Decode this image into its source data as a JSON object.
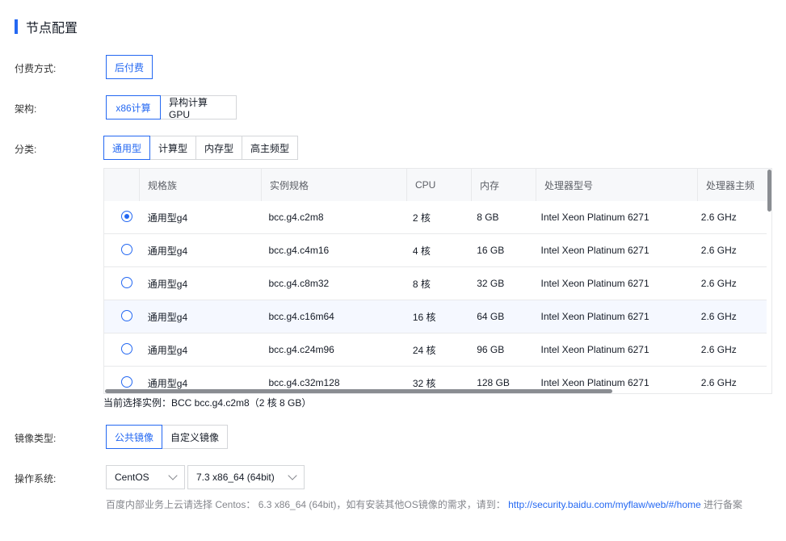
{
  "section_title": "节点配置",
  "payment": {
    "label": "付费方式:",
    "options": [
      "后付费"
    ],
    "selected": 0
  },
  "arch": {
    "label": "架构:",
    "options": [
      "x86计算",
      "异构计算GPU"
    ],
    "selected": 0
  },
  "category": {
    "label": "分类:",
    "options": [
      "通用型",
      "计算型",
      "内存型",
      "高主频型"
    ],
    "selected": 0
  },
  "table": {
    "headers": [
      "规格族",
      "实例规格",
      "CPU",
      "内存",
      "处理器型号",
      "处理器主频"
    ],
    "rows": [
      {
        "family": "通用型g4",
        "spec": "bcc.g4.c2m8",
        "cpu": "2 核",
        "mem": "8 GB",
        "model": "Intel Xeon Platinum 6271",
        "freq": "2.6 GHz",
        "checked": true
      },
      {
        "family": "通用型g4",
        "spec": "bcc.g4.c4m16",
        "cpu": "4 核",
        "mem": "16 GB",
        "model": "Intel Xeon Platinum 6271",
        "freq": "2.6 GHz",
        "checked": false
      },
      {
        "family": "通用型g4",
        "spec": "bcc.g4.c8m32",
        "cpu": "8 核",
        "mem": "32 GB",
        "model": "Intel Xeon Platinum 6271",
        "freq": "2.6 GHz",
        "checked": false
      },
      {
        "family": "通用型g4",
        "spec": "bcc.g4.c16m64",
        "cpu": "16 核",
        "mem": "64 GB",
        "model": "Intel Xeon Platinum 6271",
        "freq": "2.6 GHz",
        "checked": false
      },
      {
        "family": "通用型g4",
        "spec": "bcc.g4.c24m96",
        "cpu": "24 核",
        "mem": "96 GB",
        "model": "Intel Xeon Platinum 6271",
        "freq": "2.6 GHz",
        "checked": false
      },
      {
        "family": "通用型g4",
        "spec": "bcc.g4.c32m128",
        "cpu": "32 核",
        "mem": "128 GB",
        "model": "Intel Xeon Platinum 6271",
        "freq": "2.6 GHz",
        "checked": false
      }
    ]
  },
  "selected_instance": "当前选择实例：BCC bcc.g4.c2m8（2 核 8 GB）",
  "image_type": {
    "label": "镜像类型:",
    "options": [
      "公共镜像",
      "自定义镜像"
    ],
    "selected": 0
  },
  "os": {
    "label": "操作系统:",
    "os_value": "CentOS",
    "version_value": "7.3 x86_64 (64bit)"
  },
  "hint": {
    "text_before": "百度内部业务上云请选择 Centos： 6.3 x86_64 (64bit)，如有安装其他OS镜像的需求，请到：",
    "link": "http://security.baidu.com/myflaw/web/#/home",
    "text_after": " 进行备案"
  },
  "colors": {
    "accent": "#2468f2"
  }
}
